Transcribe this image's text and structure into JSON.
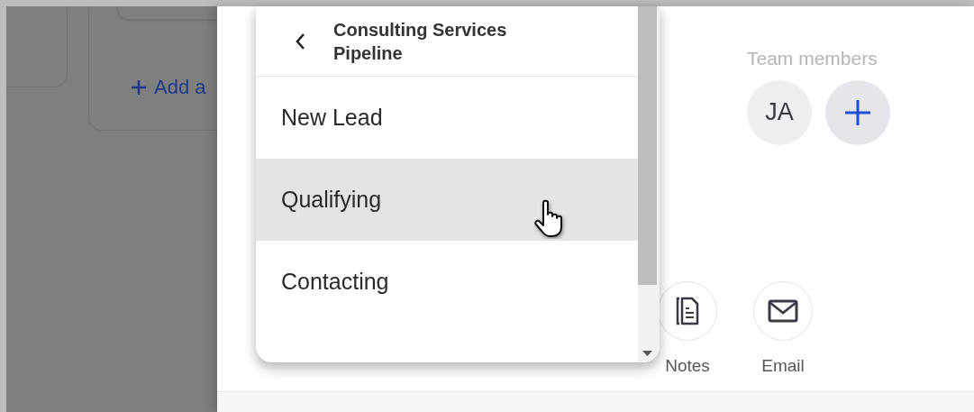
{
  "background_board": {
    "add_link": "Add a"
  },
  "stage_menu": {
    "title": "Consulting Services Pipeline",
    "items": [
      {
        "label": "New Lead",
        "selected": false
      },
      {
        "label": "Qualifying",
        "selected": true
      },
      {
        "label": "Contacting",
        "selected": false
      }
    ]
  },
  "team_members": {
    "label": "Team members",
    "members": [
      {
        "initials": "JA"
      }
    ]
  },
  "actions": [
    {
      "kind": "notes",
      "label": "Notes"
    },
    {
      "kind": "email",
      "label": "Email"
    }
  ]
}
